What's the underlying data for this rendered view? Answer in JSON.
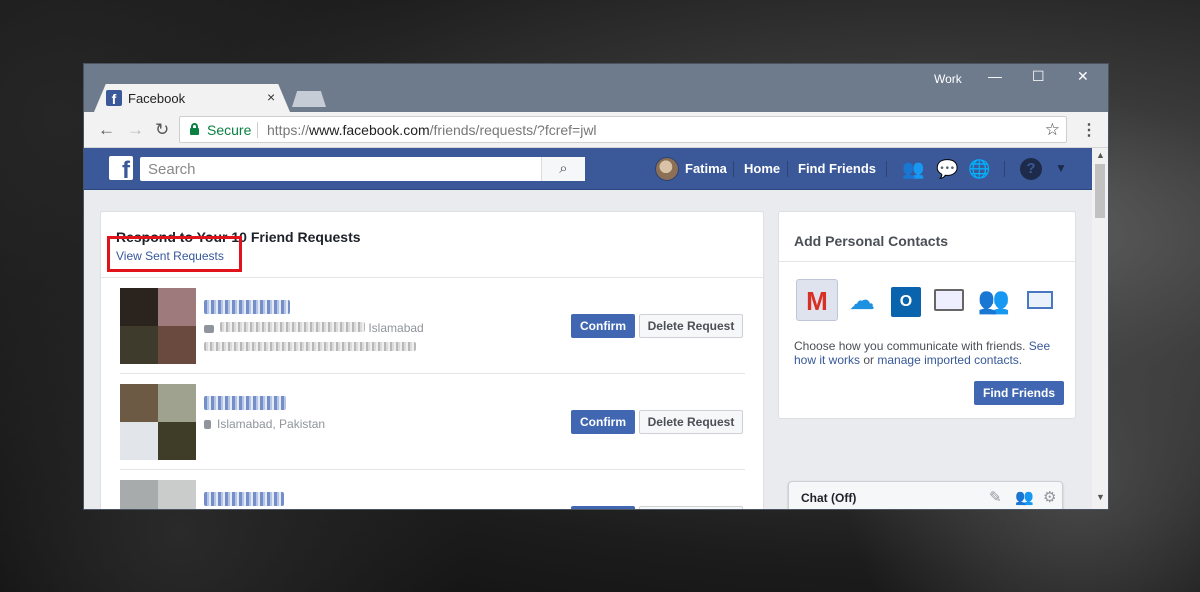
{
  "browser": {
    "tab_title": "Facebook",
    "tab_close": "×",
    "profile_label": "Work",
    "security_label": "Secure",
    "url_scheme": "https://",
    "url_host": "www.facebook.com",
    "url_path": "/friends/requests/?fcref=jwl",
    "window_controls": {
      "minimize": "—",
      "maximize": "☐",
      "close": "✕"
    }
  },
  "fbbar": {
    "logo": "f",
    "search_placeholder": "Search",
    "user_name": "Fatima",
    "home_label": "Home",
    "find_friends_label": "Find Friends",
    "brand_color": "#3b5998"
  },
  "requests": {
    "title": "Respond to Your 10 Friend Requests",
    "view_sent_label": "View Sent Requests",
    "highlight_color": "#e0141a",
    "items": [
      {
        "location": "Islamabad",
        "confirm_label": "Confirm",
        "delete_label": "Delete Request"
      },
      {
        "location": "Islamabad, Pakistan",
        "confirm_label": "Confirm",
        "delete_label": "Delete Request"
      },
      {
        "location": "",
        "confirm_label": "",
        "delete_label": ""
      }
    ]
  },
  "contacts": {
    "title": "Add Personal Contacts",
    "providers": [
      "gmail-icon",
      "icloud-icon",
      "outlook-icon",
      "contacts-card-icon",
      "windows-live-messenger-icon",
      "mail-icon"
    ],
    "desc_text": "Choose how you communicate with friends. ",
    "desc_link_1": "See how it works",
    "desc_or": " or ",
    "desc_link_2": "manage imported contacts",
    "desc_end": ".",
    "find_friends_button": "Find Friends"
  },
  "chat": {
    "label": "Chat (Off)"
  }
}
